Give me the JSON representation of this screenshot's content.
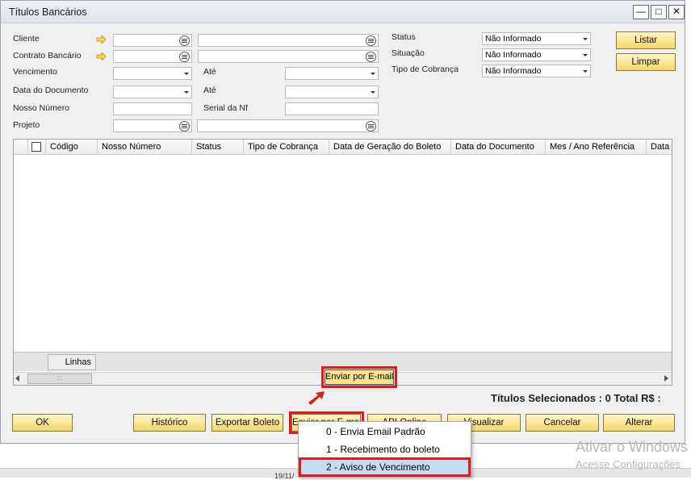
{
  "window": {
    "title": "Títulos Bancários"
  },
  "filters": {
    "cliente_label": "Cliente",
    "contrato_label": "Contrato Bancário",
    "vencimento_label": "Vencimento",
    "ate1_label": "Até",
    "data_documento_label": "Data do Documento",
    "ate2_label": "Até",
    "nosso_numero_label": "Nosso Número",
    "serial_nf_label": "Serial da Nf",
    "projeto_label": "Projeto",
    "status_label": "Status",
    "status_value": "Não Informado",
    "situacao_label": "Situação",
    "situacao_value": "Não Informado",
    "tipo_cobranca_label": "Tipo de Cobrança",
    "tipo_cobranca_value": "Não Informado"
  },
  "buttons": {
    "listar": "Listar",
    "limpar": "Limpar",
    "ok": "OK",
    "historico": "Histórico",
    "exportar_boleto": "Exportar Boleto",
    "enviar_email": "Enviar por E-mail",
    "api": "API Online",
    "visualizar": "Visualizar",
    "cancelar": "Cancelar",
    "alterar": "Alterar"
  },
  "grid": {
    "columns": [
      "Código",
      "Nosso Número",
      "Status",
      "Tipo de Cobrança",
      "Data de Geração do Boleto",
      "Data do Documento",
      "Mes / Ano Referência",
      "Data"
    ],
    "linhas_label": "Linhas",
    "scroll_grip": ":::"
  },
  "tooltip": "Enviar por E-mail",
  "totals": "Títulos Selecionados : 0 Total R$ :",
  "menu": {
    "items": [
      "0 - Envia Email Padrão",
      "1 - Recebimento do boleto",
      "2 - Aviso de Vencimento"
    ]
  },
  "watermark": {
    "line1": "Ativar o Windows",
    "line2": "Acesse Configurações"
  },
  "taskbar": {
    "date_fragment": "19/11/"
  }
}
